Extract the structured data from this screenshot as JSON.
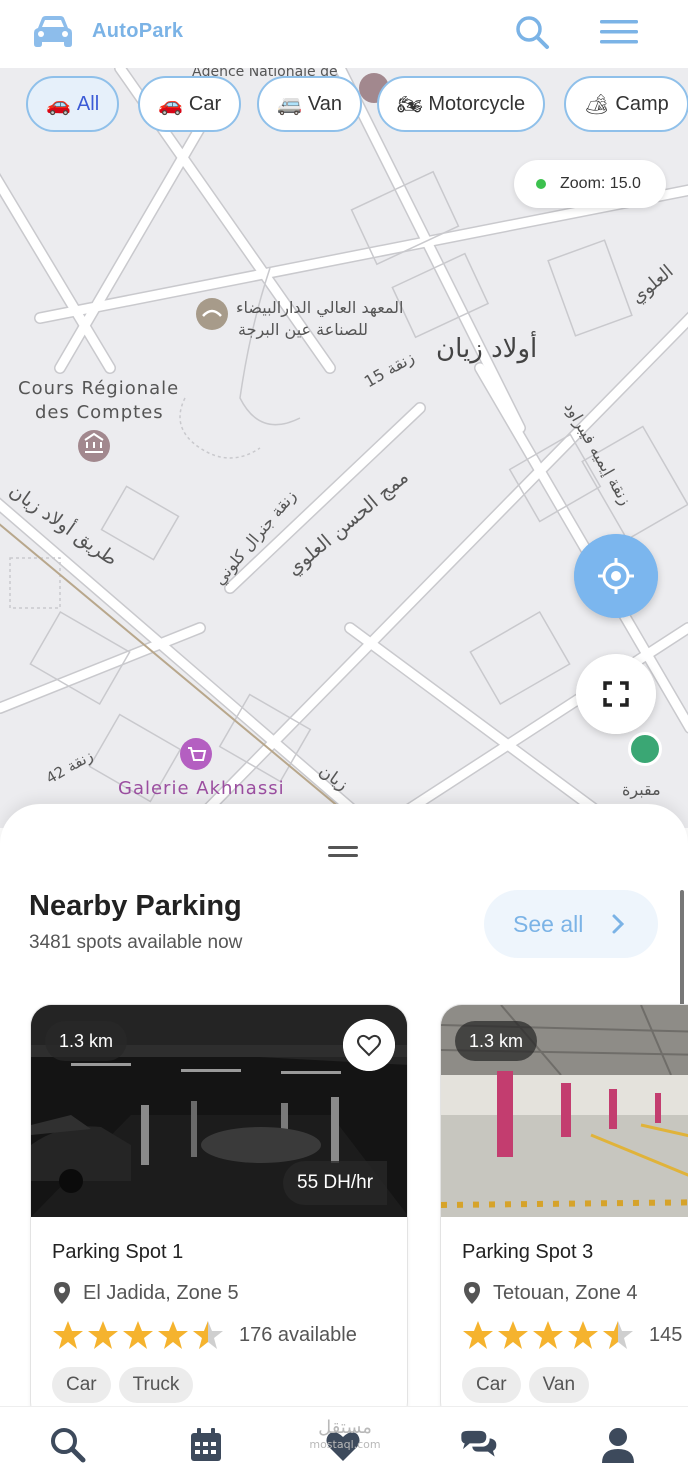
{
  "app": {
    "brand": "AutoPark",
    "logo_icon": "car-icon"
  },
  "filters": [
    {
      "emoji": "🚗",
      "label": "All",
      "active": true
    },
    {
      "emoji": "🚗",
      "label": "Car",
      "active": false
    },
    {
      "emoji": "🚐",
      "label": "Van",
      "active": false
    },
    {
      "emoji": "🏍",
      "label": "Motorcycle",
      "active": false
    },
    {
      "emoji": "🏕",
      "label": "Camp",
      "active": false
    }
  ],
  "map": {
    "zoom_label": "Zoom: 15.0",
    "labels": {
      "agency": "Agence Nationale de",
      "institute_ar_1": "المعهد العالي الدارالبيضاء",
      "institute_ar_2": "للصناعة عين البرجة",
      "ouled_zyane": "أولاد زيان",
      "cours_1": "Cours Régionale",
      "cours_2": "des Comptes",
      "street_15": "زنقة 15",
      "street_feb": "زنقة إيميه فيبراود",
      "hassan": "ممج الحسن العلوي",
      "general": "زنقة جنرال كلوني",
      "road": "طريق أولاد زيان",
      "alaoui": "العلوي",
      "galerie": "Galerie Akhnassi",
      "street_42": "زنقة 42",
      "cemetery": "مقبرة",
      "zyane_small": "زيان"
    },
    "colors": {
      "road": "#ffffff",
      "bg": "#ececef",
      "accent": "#7bb6ee"
    }
  },
  "sheet": {
    "title": "Nearby Parking",
    "subtitle": "3481 spots available now",
    "see_all": "See all"
  },
  "cards": [
    {
      "distance": "1.3 km",
      "price": "55 DH/hr",
      "name": "Parking Spot 1",
      "location": "El Jadida, Zone 5",
      "rating": 4.5,
      "available": "176 available",
      "tags": [
        "Car",
        "Truck"
      ]
    },
    {
      "distance": "1.3 km",
      "price": "",
      "name": "Parking Spot 3",
      "location": "Tetouan, Zone 4",
      "rating": 4.5,
      "available": "145",
      "tags": [
        "Car",
        "Van"
      ]
    }
  ],
  "nav": {
    "items": [
      "search-icon",
      "calendar-icon",
      "heart-icon",
      "chat-icon",
      "user-icon"
    ],
    "watermark": "مستقل",
    "watermark_sub": "mostaql.com"
  }
}
